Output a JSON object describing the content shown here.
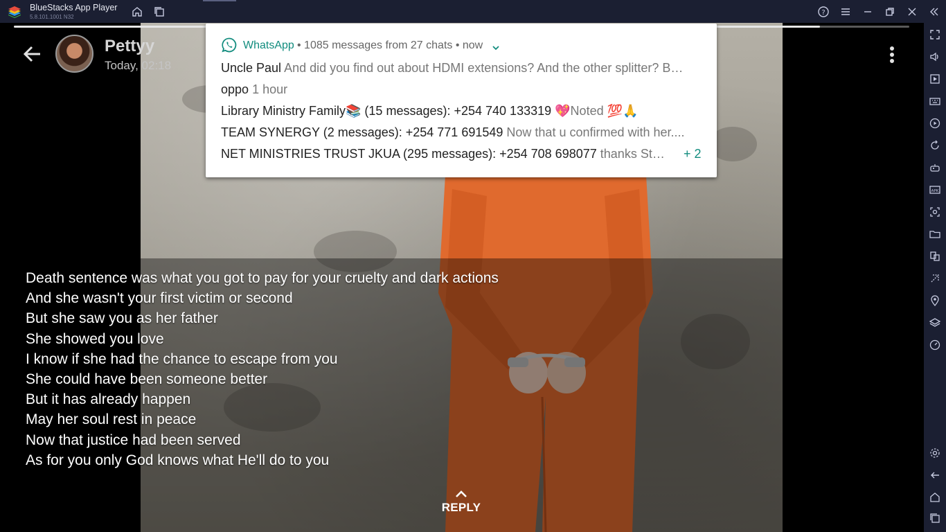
{
  "window": {
    "title": "BlueStacks App Player",
    "version": "5.8.101.1001 N32"
  },
  "status": {
    "contact_name": "Pettyy",
    "timestamp": "Today, 02:18",
    "progress": 0.9,
    "caption_lines": [
      "Death sentence was what you got to pay for your cruelty and dark actions",
      "And she wasn't your first victim or second",
      "But she saw you as her father",
      "She showed you love",
      "I know if she had the chance to escape from you",
      "She could have been someone better",
      "But it has already happen",
      "May her soul rest in peace",
      "Now that justice had been served",
      "As for you only God knows what He'll do to you"
    ],
    "reply_label": "REPLY"
  },
  "notification": {
    "app": "WhatsApp",
    "meta": "• 1085 messages from 27 chats • now",
    "rows": [
      {
        "sender": "Uncle Paul",
        "message": "And did you find out about HDMI extensions? And the other splitter? B…"
      },
      {
        "sender": "oppo",
        "message": "1 hour"
      },
      {
        "sender": "Library Ministry Family📚 (15 messages): +254 740 133319",
        "message": "💖Noted 💯🙏"
      },
      {
        "sender": "TEAM SYNERGY (2 messages): +254 771 691549",
        "message": "Now that u confirmed with her...."
      },
      {
        "sender": "NET MINISTRIES TRUST JKUA (295 messages): +254 708 698077",
        "message": "thanks St…"
      }
    ],
    "more": "+ 2"
  },
  "colors": {
    "whatsapp_green": "#128c7e",
    "titlebar": "#1b1f32",
    "jumpsuit": "#e06a2e"
  }
}
